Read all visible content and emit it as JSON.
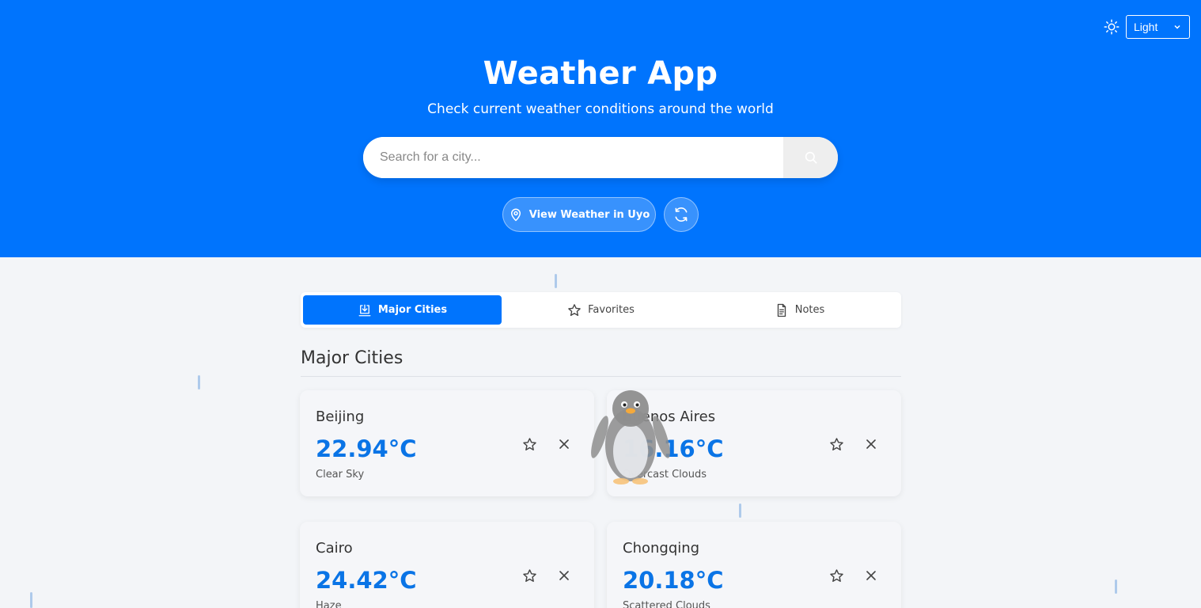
{
  "theme": {
    "icon": "sun-icon",
    "selected": "Light"
  },
  "header": {
    "title": "Weather App",
    "subtitle": "Check current weather conditions around the world",
    "bg_color": "#0074fd"
  },
  "search": {
    "placeholder": "Search for a city...",
    "value": ""
  },
  "location": {
    "label": "View Weather in Uyo"
  },
  "tabs": [
    {
      "label": "Major Cities",
      "icon": "download-icon",
      "active": true
    },
    {
      "label": "Favorites",
      "icon": "star-icon",
      "active": false
    },
    {
      "label": "Notes",
      "icon": "document-icon",
      "active": false
    }
  ],
  "section": {
    "title": "Major Cities"
  },
  "cities": [
    {
      "name": "Beijing",
      "temp": "22.94°C",
      "desc": "Clear Sky"
    },
    {
      "name": "Buenos Aires",
      "temp": "16.16°C",
      "desc": "Overcast Clouds"
    },
    {
      "name": "Cairo",
      "temp": "24.42°C",
      "desc": "Haze"
    },
    {
      "name": "Chongqing",
      "temp": "20.18°C",
      "desc": "Scattered Clouds"
    }
  ],
  "colors": {
    "accent": "#0074fd",
    "temp": "#0a74e6",
    "background": "#f3f5f8"
  }
}
